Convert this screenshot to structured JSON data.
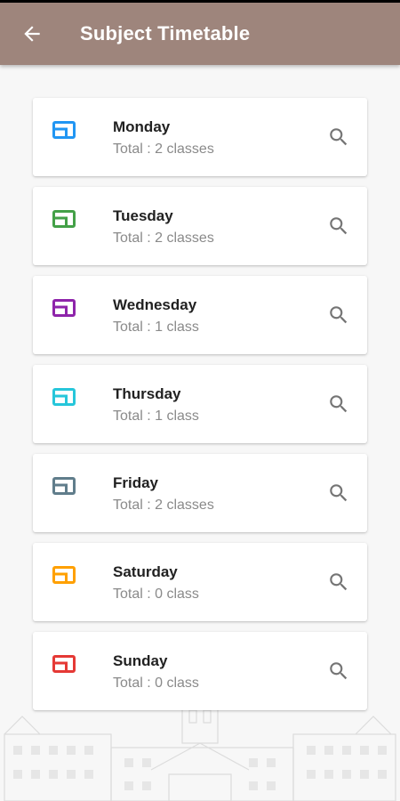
{
  "header": {
    "title": "Subject Timetable",
    "back_icon": "arrow-left-icon",
    "background_color": "#9e857c"
  },
  "days": [
    {
      "name": "Monday",
      "total": "Total : 2 classes",
      "icon": "view-quilt-icon",
      "color": "#2196f3"
    },
    {
      "name": "Tuesday",
      "total": "Total : 2 classes",
      "icon": "view-quilt-icon",
      "color": "#43a047"
    },
    {
      "name": "Wednesday",
      "total": "Total : 1 class",
      "icon": "view-quilt-icon",
      "color": "#8e24aa"
    },
    {
      "name": "Thursday",
      "total": "Total : 1 class",
      "icon": "view-quilt-icon",
      "color": "#26c6da"
    },
    {
      "name": "Friday",
      "total": "Total : 2 classes",
      "icon": "view-quilt-icon",
      "color": "#607d8b"
    },
    {
      "name": "Saturday",
      "total": "Total : 0 class",
      "icon": "view-quilt-icon",
      "color": "#ffa000"
    },
    {
      "name": "Sunday",
      "total": "Total : 0 class",
      "icon": "view-quilt-icon",
      "color": "#e53935"
    }
  ],
  "search_icon": "search-icon",
  "search_icon_color": "#757575"
}
